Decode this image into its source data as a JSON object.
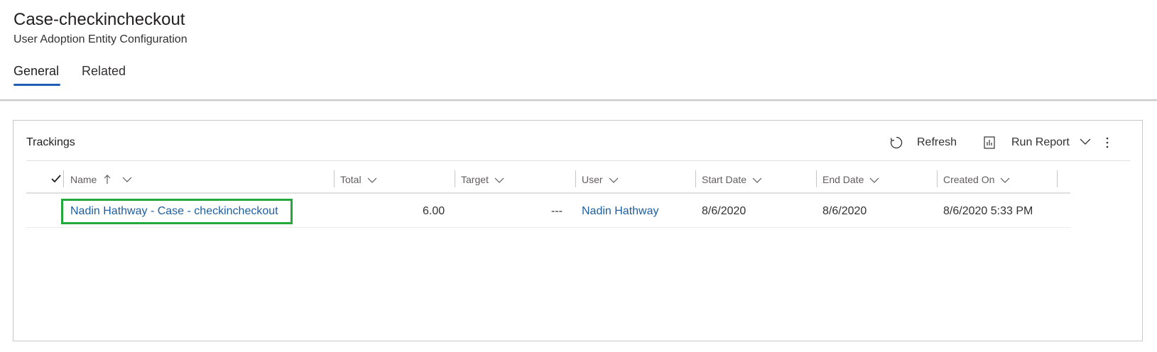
{
  "header": {
    "title": "Case-checkincheckout",
    "subtitle": "User Adoption Entity Configuration",
    "tabs": [
      {
        "label": "General",
        "selected": true
      },
      {
        "label": "Related",
        "selected": false
      }
    ]
  },
  "subgrid": {
    "title": "Trackings",
    "commands": {
      "refresh": "Refresh",
      "run_report": "Run Report"
    },
    "columns": [
      "Name",
      "Total",
      "Target",
      "User",
      "Start Date",
      "End Date",
      "Created On"
    ],
    "sort": {
      "column": "Name",
      "direction": "ascending"
    },
    "rows": [
      {
        "name": "Nadin Hathway - Case - checkincheckout",
        "total": "6.00",
        "target": "---",
        "user": "Nadin Hathway",
        "start_date": "8/6/2020",
        "end_date": "8/6/2020",
        "created_on": "8/6/2020 5:33 PM"
      }
    ]
  },
  "colors": {
    "accent": "#1e5fb4",
    "link": "#1e5fa0",
    "highlight_border": "#22a83b"
  },
  "icons": [
    "refresh-icon",
    "report-icon",
    "chevron-down-icon",
    "more-icon",
    "checkmark-icon",
    "sort-up-arrow-icon"
  ]
}
